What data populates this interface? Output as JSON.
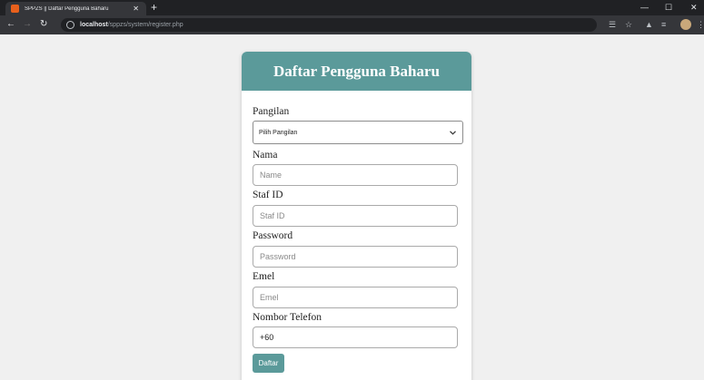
{
  "browser": {
    "tab_title": "SPPZS || Daftar Pengguna Baharu",
    "tab_close": "✕",
    "new_tab": "+",
    "url_host": "localhost",
    "url_path": "/sppzs/system/register.php",
    "window_controls": {
      "minimize": "—",
      "maximize": "☐",
      "close": "✕"
    }
  },
  "form": {
    "title": "Daftar Pengguna Baharu",
    "fields": {
      "pangilan": {
        "label": "Pangilan",
        "selected": "Pilih Pangilan"
      },
      "nama": {
        "label": "Nama",
        "placeholder": "Name",
        "value": ""
      },
      "staf_id": {
        "label": "Staf ID",
        "placeholder": "Staf ID",
        "value": ""
      },
      "password": {
        "label": "Password",
        "placeholder": "Password",
        "value": ""
      },
      "emel": {
        "label": "Emel",
        "placeholder": "Emel",
        "value": ""
      },
      "telefon": {
        "label": "Nombor Telefon",
        "placeholder": "",
        "value": "+60"
      }
    },
    "submit_label": "Daftar"
  },
  "colors": {
    "accent": "#5b9a9a",
    "page_bg": "#f0f0f0",
    "chrome_dark": "#202124",
    "chrome_toolbar": "#35363a"
  }
}
